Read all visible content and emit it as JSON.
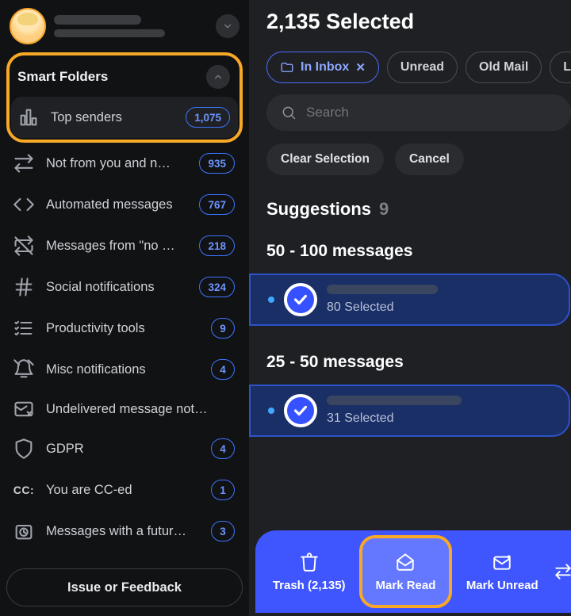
{
  "sidebar": {
    "section_title": "Smart Folders",
    "items": [
      {
        "icon": "bar-chart-icon",
        "label": "Top senders",
        "count": "1,075",
        "active": true
      },
      {
        "icon": "double-arrow-icon",
        "label": "Not from you and n…",
        "count": "935"
      },
      {
        "icon": "code-icon",
        "label": "Automated messages",
        "count": "767"
      },
      {
        "icon": "repeat-off-icon",
        "label": "Messages from \"no …",
        "count": "218"
      },
      {
        "icon": "hash-icon",
        "label": "Social notifications",
        "count": "324"
      },
      {
        "icon": "list-check-icon",
        "label": "Productivity tools",
        "count": "9"
      },
      {
        "icon": "bell-off-icon",
        "label": "Misc notifications",
        "count": "4"
      },
      {
        "icon": "inbox-x-icon",
        "label": "Undelivered message not…",
        "count": ""
      },
      {
        "icon": "shield-icon",
        "label": "GDPR",
        "count": "4"
      },
      {
        "icon": "cc-icon",
        "label": "You are CC-ed",
        "count": "1"
      },
      {
        "icon": "clock-icon",
        "label": "Messages with a futur…",
        "count": "3"
      }
    ],
    "feedback_label": "Issue or Feedback"
  },
  "main": {
    "title": "2,135 Selected",
    "chips": [
      {
        "label": "In Inbox",
        "active": true
      },
      {
        "label": "Unread"
      },
      {
        "label": "Old Mail"
      },
      {
        "label": "La"
      }
    ],
    "search_placeholder": "Search",
    "clear_label": "Clear Selection",
    "cancel_label": "Cancel",
    "suggestions_label": "Suggestions",
    "suggestions_count": "9",
    "groups": [
      {
        "header": "50 - 100 messages",
        "selected_text": "80 Selected"
      },
      {
        "header": "25 - 50 messages",
        "selected_text": "31 Selected"
      }
    ],
    "toolbar": {
      "trash": "Trash (2,135)",
      "mark_read": "Mark Read",
      "mark_unread": "Mark Unread"
    }
  }
}
